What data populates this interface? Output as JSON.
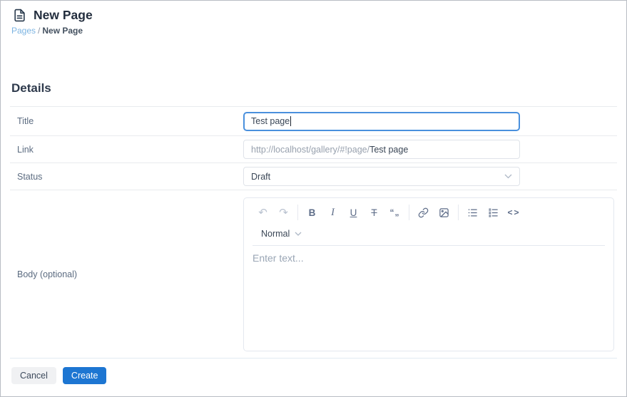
{
  "page": {
    "title": "New Page"
  },
  "breadcrumb": {
    "parent": "Pages",
    "separator": "/",
    "current": "New Page"
  },
  "details": {
    "heading": "Details"
  },
  "form": {
    "title": {
      "label": "Title",
      "value": "Test page"
    },
    "link": {
      "label": "Link",
      "prefix": "http://localhost/gallery/#!page/",
      "value": "Test page"
    },
    "status": {
      "label": "Status",
      "value": "Draft"
    },
    "body": {
      "label": "Body (optional)"
    }
  },
  "editor": {
    "format": "Normal",
    "placeholder": "Enter text...",
    "buttons": {
      "bold": "B",
      "italic": "I",
      "underline": "U",
      "strikethrough": "T",
      "blockquote": "“„",
      "code": "<>"
    }
  },
  "actions": {
    "cancel": "Cancel",
    "create": "Create"
  },
  "colors": {
    "accent": "#1d76d2",
    "focus_border": "#4a90dd",
    "breadcrumb_link": "#7cb4e2",
    "icon": "#5e6d89",
    "divider": "#e9ebee"
  }
}
